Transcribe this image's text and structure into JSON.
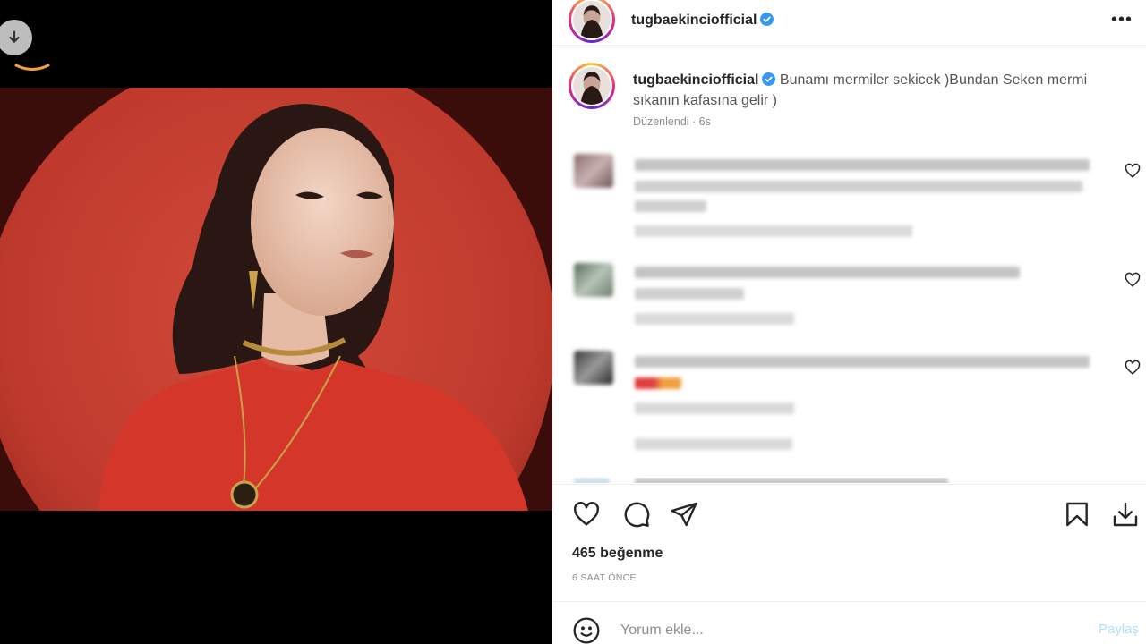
{
  "post": {
    "username": "tugbaekinciofficial",
    "verified": true,
    "caption_text": "Bunamı mermiler sekicek )Bundan Seken mermi sıkanın kafasına gelir )",
    "caption_meta": "Düzenlendi · 6s",
    "likes_text": "465 beğenme",
    "time_ago": "6 SAAT ÖNCE"
  },
  "comment_box": {
    "placeholder": "Yorum ekle...",
    "share_label": "Paylaş"
  },
  "icons": {
    "download_badge": "download-arrow-icon",
    "more": "more-options-icon",
    "like": "heart-icon",
    "comment": "comment-bubble-icon",
    "share": "paper-plane-icon",
    "save": "bookmark-icon",
    "download": "download-icon",
    "emoji": "smiley-icon",
    "verified": "verified-badge-icon"
  },
  "colors": {
    "accent_blue": "#0095f6",
    "share_disabled": "#b2dffc",
    "photo_background": "#b8352a",
    "verified_blue": "#3897f0"
  }
}
